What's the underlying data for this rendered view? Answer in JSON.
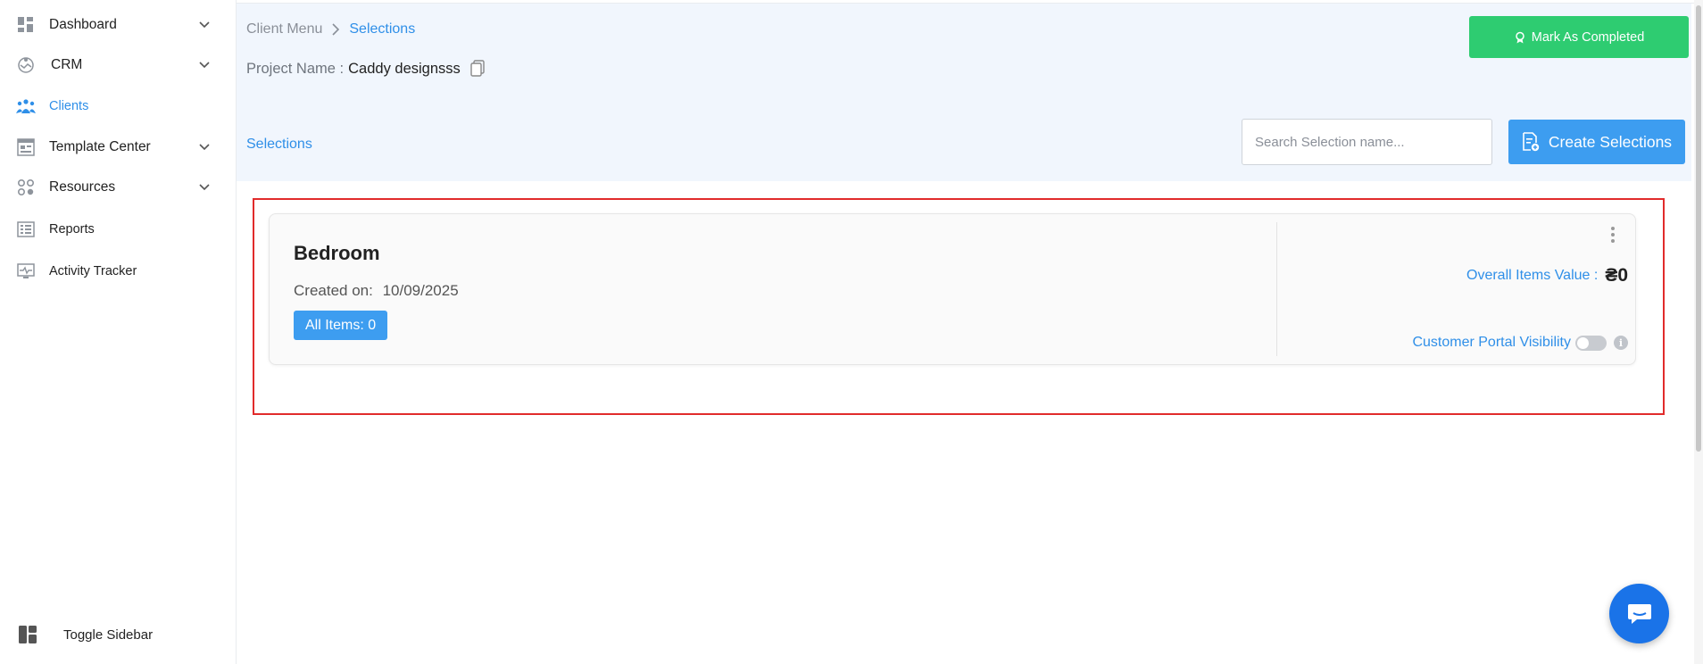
{
  "sidebar": {
    "items": [
      {
        "label": "Dashboard",
        "icon": "dashboard-icon",
        "has_chevron": true
      },
      {
        "label": "CRM",
        "icon": "handshake-icon",
        "has_chevron": true
      },
      {
        "label": "Clients",
        "icon": "clients-icon",
        "has_chevron": false,
        "active": true
      },
      {
        "label": "Template Center",
        "icon": "template-icon",
        "has_chevron": true
      },
      {
        "label": "Resources",
        "icon": "resources-icon",
        "has_chevron": true
      },
      {
        "label": "Reports",
        "icon": "reports-icon",
        "has_chevron": false
      },
      {
        "label": "Activity Tracker",
        "icon": "activity-icon",
        "has_chevron": false
      }
    ],
    "toggle_label": "Toggle Sidebar"
  },
  "breadcrumb": {
    "root": "Client Menu",
    "current": "Selections"
  },
  "project": {
    "label": "Project Name :",
    "value": "Caddy designsss"
  },
  "header": {
    "mark_completed_label": "Mark As Completed",
    "selections_link": "Selections",
    "search_placeholder": "Search Selection name...",
    "create_label": "Create Selections"
  },
  "card": {
    "title": "Bedroom",
    "created_label": "Created on:",
    "created_date": "10/09/2025",
    "items_badge": "All Items: 0",
    "overall_label": "Overall Items Value :",
    "overall_value": "₴0",
    "visibility_label": "Customer Portal Visibility",
    "visibility_on": false
  },
  "colors": {
    "accent": "#2f8fe8",
    "success": "#2ecc71",
    "primary_button": "#3d9df0",
    "highlight_border": "#e12b2b",
    "header_bg": "#f1f6fd"
  }
}
